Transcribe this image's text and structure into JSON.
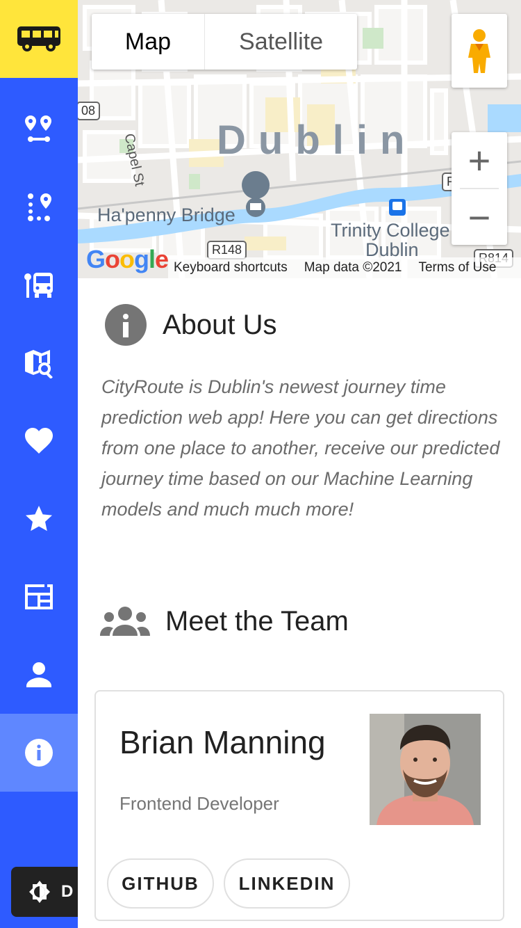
{
  "sidebar": {
    "brand_icon": "bus-icon",
    "brand_color": "#ffe53b",
    "bg_color": "#2e5bff",
    "active_color": "#5f87ff",
    "items": [
      {
        "icon": "route-directions-icon"
      },
      {
        "icon": "route-stops-icon"
      },
      {
        "icon": "bus-stop-icon"
      },
      {
        "icon": "map-search-icon"
      },
      {
        "icon": "heart-icon"
      },
      {
        "icon": "star-icon"
      },
      {
        "icon": "newspaper-icon"
      },
      {
        "icon": "person-icon"
      },
      {
        "icon": "info-icon",
        "active": true
      }
    ],
    "theme_toggle": {
      "icon": "theme-brightness-icon",
      "label": "D"
    }
  },
  "map": {
    "type_buttons": {
      "map": "Map",
      "satellite": "Satellite"
    },
    "zoom_in": "+",
    "zoom_out": "−",
    "labels": {
      "city": "Dublin",
      "street": "Capel St",
      "bridge": "Ha'penny Bridge",
      "college_line1": "Trinity College",
      "college_line2": "Dublin"
    },
    "roads": {
      "r108": "08",
      "r148": "R148",
      "r814": "R814",
      "r_right": "R"
    },
    "google": "Google",
    "footer": {
      "shortcuts": "Keyboard shortcuts",
      "map_data": "Map data ©2021",
      "terms": "Terms of Use"
    }
  },
  "about": {
    "title": "About Us",
    "icon": "info-circle-icon",
    "text": "CityRoute is Dublin's newest journey time prediction web app! Here you can get directions from one place to another, receive our predicted journey time based on our Machine Learning models and much much more!"
  },
  "team": {
    "title": "Meet the Team",
    "icon": "group-icon",
    "members": [
      {
        "name": "Brian Manning",
        "role": "Frontend Developer",
        "github_label": "GITHUB",
        "linkedin_label": "LINKEDIN"
      }
    ]
  }
}
